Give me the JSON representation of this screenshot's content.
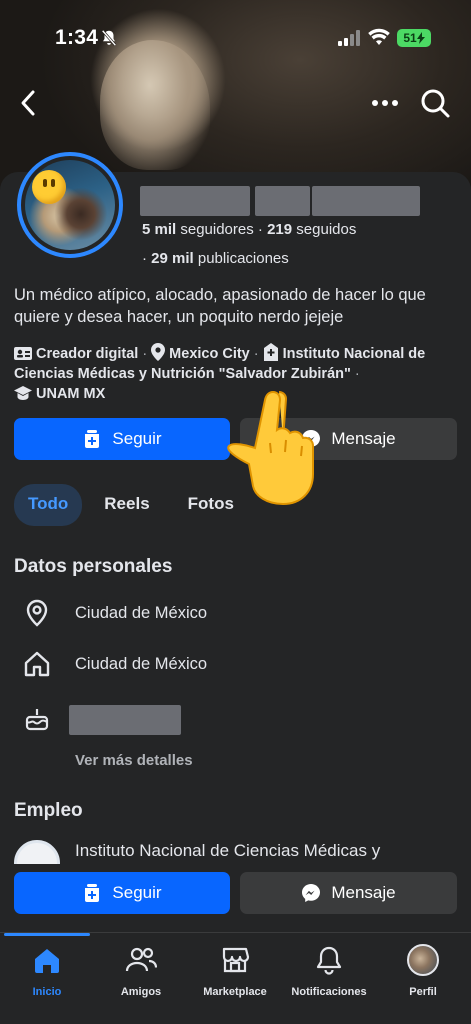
{
  "status_bar": {
    "time": "1:34",
    "battery": "51"
  },
  "profile": {
    "followers_count": "5 mil",
    "followers_label": " seguidores",
    "following_count": "219",
    "following_label": " seguidos",
    "posts_count": "29 mil",
    "posts_label": " publicaciones",
    "bio": "Un médico atípico, alocado, apasionado de hacer lo que quiere y desea hacer, un poquito nerdo jejeje",
    "role": "Creador digital",
    "city": "Mexico City",
    "institute": "Instituto Nacional de Ciencias Médicas y Nutrición \"Salvador Zubirán\"",
    "school": "UNAM MX"
  },
  "actions": {
    "follow_label": "Seguir",
    "message_label": "Mensaje"
  },
  "tabs": [
    {
      "label": "Todo",
      "active": true
    },
    {
      "label": "Reels",
      "active": false
    },
    {
      "label": "Fotos",
      "active": false
    }
  ],
  "personal": {
    "title": "Datos personales",
    "current_city": "Ciudad de México",
    "hometown": "Ciudad de México",
    "see_more": "Ver más detalles"
  },
  "work": {
    "title": "Empleo",
    "employer": "Instituto Nacional de Ciencias Médicas y"
  },
  "nav": [
    {
      "label": "Inicio",
      "icon": "home-icon",
      "active": true
    },
    {
      "label": "Amigos",
      "icon": "friends-icon",
      "active": false
    },
    {
      "label": "Marketplace",
      "icon": "marketplace-icon",
      "active": false
    },
    {
      "label": "Notificaciones",
      "icon": "bell-icon",
      "active": false
    },
    {
      "label": "Perfil",
      "icon": "profile-avatar",
      "active": false
    }
  ],
  "colors": {
    "accent": "#0866ff",
    "active_blue": "#2d88ff",
    "background": "#242526",
    "secondary_button": "#3a3b3c"
  }
}
